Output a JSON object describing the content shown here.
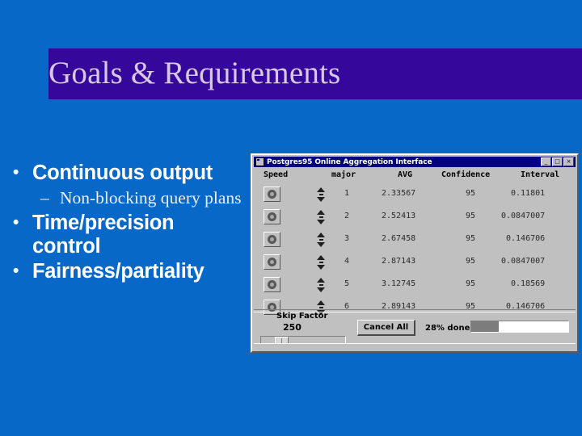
{
  "slide": {
    "background_color": "#0868c8",
    "title": "Goals & Requirements",
    "title_band_color": "#35089b",
    "title_text_color": "#d8c8e8",
    "bullets": [
      {
        "level": 1,
        "text": "Continuous output"
      },
      {
        "level": 2,
        "text": "Non-blocking query plans"
      },
      {
        "level": 1,
        "text": "Time/precision control"
      },
      {
        "level": 1,
        "text": "Fairness/partiality"
      }
    ]
  },
  "app_window": {
    "title": "Postgres95 Online Aggregation Interface",
    "titlebar_color": "#000080",
    "window_face_color": "#c0c0c0",
    "titlebar_buttons": [
      {
        "name": "minimize",
        "glyph": "_"
      },
      {
        "name": "maximize",
        "glyph": "□"
      },
      {
        "name": "close",
        "glyph": "×"
      }
    ],
    "table": {
      "columns": [
        "Speed",
        "major",
        "AVG",
        "Confidence",
        "Interval"
      ],
      "rows": [
        {
          "speed": "speed-knob",
          "spinner": "major-spinner",
          "major": "1",
          "avg": "2.33567",
          "confidence": "95",
          "interval": "0.11801"
        },
        {
          "speed": "speed-knob",
          "spinner": "major-spinner",
          "major": "2",
          "avg": "2.52413",
          "confidence": "95",
          "interval": "0.0847007"
        },
        {
          "speed": "speed-knob",
          "spinner": "major-spinner",
          "major": "3",
          "avg": "2.67458",
          "confidence": "95",
          "interval": "0.146706"
        },
        {
          "speed": "speed-knob",
          "spinner": "major-spinner",
          "major": "4",
          "avg": "2.87143",
          "confidence": "95",
          "interval": "0.0847007"
        },
        {
          "speed": "speed-knob",
          "spinner": "major-spinner",
          "major": "5",
          "avg": "3.12745",
          "confidence": "95",
          "interval": "0.18569"
        },
        {
          "speed": "speed-knob",
          "spinner": "major-spinner",
          "major": "6",
          "avg": "2.89143",
          "confidence": "95",
          "interval": "0.146706"
        }
      ]
    },
    "controls": {
      "skip_factor_label": "Skip Factor",
      "skip_factor_value": "250",
      "skip_factor_slider_percent": 16,
      "cancel_all_label": "Cancel All",
      "progress_label": "28% done",
      "progress_percent": 28,
      "progress_fill_color": "#7c7c7c"
    }
  }
}
